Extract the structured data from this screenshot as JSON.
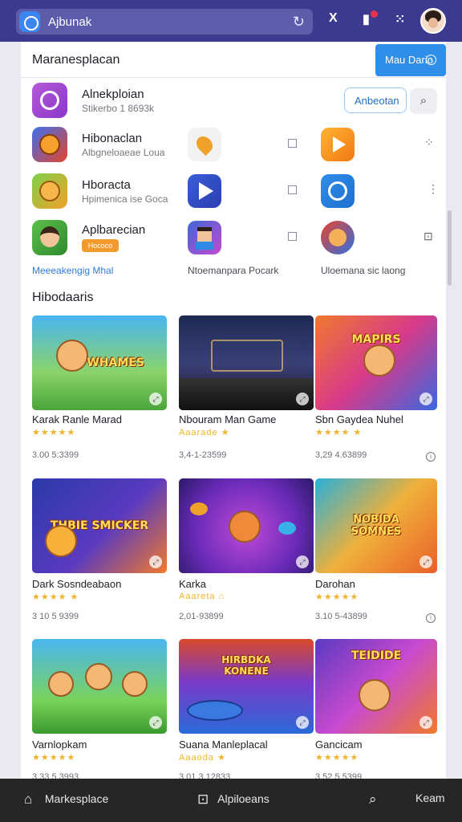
{
  "browser": {
    "url_text": "Ajbunak",
    "reload_glyph": "↻",
    "icons": [
      "X",
      "▮",
      "⁙"
    ]
  },
  "panel": {
    "title": "Maranesplacan",
    "head_button": "Mau Dario",
    "featured": {
      "name": "Alnekploian",
      "sub": "Stikerbo 1 8693k",
      "button": "Anbeotan"
    },
    "rows": [
      {
        "name": "Hibonaclan",
        "sub": "Albgneloaeae Loua"
      },
      {
        "name": "Hboracta",
        "sub": "Hpimenica ise Goca"
      },
      {
        "name": "Aplbarecian",
        "sub": "Hococo"
      }
    ],
    "captions": [
      "Meeeakengig Mhal",
      "Ntoemanpara Pocark",
      "Uloemana sic laong"
    ]
  },
  "section_title": "Hibodaaris",
  "games": [
    {
      "title": "Karak Ranle Marad",
      "stars": "★★★★★",
      "count": "3.00 5:3399",
      "logo": "WHAMES"
    },
    {
      "title": "Nbouram Man Game",
      "stars": "Aaarade ★",
      "count": "3,4-1-23599",
      "logo": ""
    },
    {
      "title": "Sbn Gaydea Nuhel",
      "stars": "★★★★ ★",
      "count": "3,29 4.63899",
      "logo": "MAPIRS"
    },
    {
      "title": "Dark Sosndeabaon",
      "stars": "★★★★ ★",
      "count": "3 10 5 9399",
      "logo": "THBIE SMICKER"
    },
    {
      "title": "Karka",
      "stars": "Aaareta ⌂",
      "count": "2,01-93899",
      "logo": ""
    },
    {
      "title": "Darohan",
      "stars": "★★★★★",
      "count": "3.10 5-43899",
      "logo": "NOBIDA SOMNES"
    },
    {
      "title": "Varnlopkam",
      "stars": "★★★★★",
      "count": "3,33 5,3993",
      "logo": ""
    },
    {
      "title": "Suana Manleplacal",
      "stars": "Aaaoda ★",
      "count": "3,01 3,12833",
      "logo": "HIRBDKA KONENE"
    },
    {
      "title": "Gancicam",
      "stars": "★★★★★",
      "count": "3,52 5,5399",
      "logo": "TEIDIDE"
    }
  ],
  "bottom_nav": [
    {
      "label": "Markesplace",
      "icon": "⌂"
    },
    {
      "label": "Alpiloeans",
      "icon": "⊡"
    },
    {
      "label": "",
      "icon": "⌕"
    },
    {
      "label": "Keam",
      "icon": ""
    }
  ],
  "colors": {
    "topbar": "#3b3a8e",
    "accent": "#2f8ee7",
    "star": "#f0b42c",
    "bottom_nav": "#262626"
  }
}
